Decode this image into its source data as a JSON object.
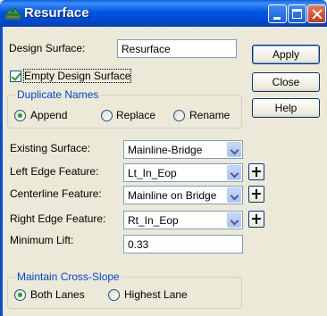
{
  "window": {
    "title": "Resurface"
  },
  "design_surface": {
    "label": "Design Surface:",
    "value": "Resurface"
  },
  "empty_design_surface": {
    "label": "Empty Design Surface",
    "checked": true
  },
  "duplicate_names": {
    "legend": "Duplicate Names",
    "options": [
      "Append",
      "Replace",
      "Rename"
    ],
    "selected": "Append"
  },
  "fields": {
    "existing_surface": {
      "label": "Existing Surface:",
      "value": "Mainline-Bridge"
    },
    "left_edge": {
      "label": "Left Edge Feature:",
      "value": "Lt_In_Eop"
    },
    "centerline": {
      "label": "Centerline Feature:",
      "value": "Mainline on Bridge"
    },
    "right_edge": {
      "label": "Right Edge Feature:",
      "value": "Rt_In_Eop"
    },
    "minimum_lift": {
      "label": "Minimum Lift:",
      "value": "0.33"
    }
  },
  "cross_slope": {
    "legend": "Maintain Cross-Slope",
    "options": [
      "Both Lanes",
      "Highest Lane"
    ],
    "selected": "Both Lanes"
  },
  "buttons": {
    "apply": "Apply",
    "close": "Close",
    "help": "Help"
  },
  "colors": {
    "titlebar": "#0055e5",
    "group_legend": "#0046d5",
    "window_bg": "#ece9d8"
  }
}
